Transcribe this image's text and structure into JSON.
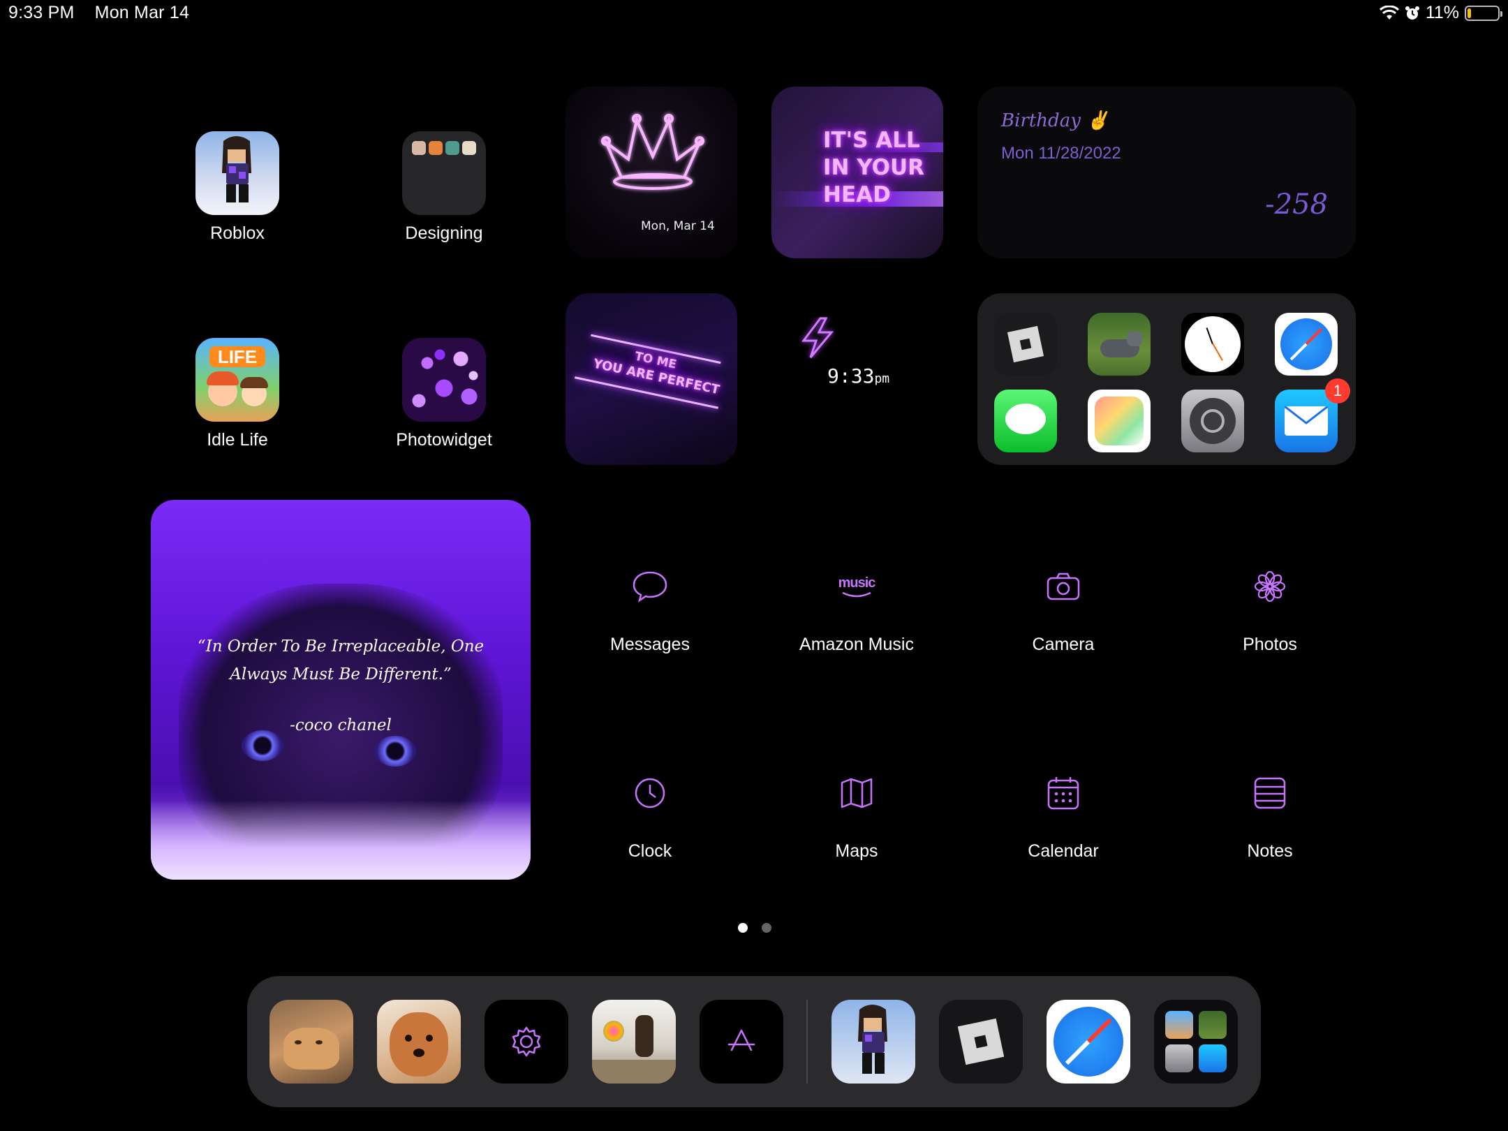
{
  "status_bar": {
    "time": "9:33 PM",
    "date": "Mon Mar 14",
    "battery": "11%",
    "battery_level": 0.11
  },
  "apps": {
    "roblox": "Roblox",
    "designing": "Designing",
    "idle_life": "Idle Life",
    "photowidget": "Photowidget"
  },
  "widgets": {
    "crown_date": "Mon, Mar 14",
    "neon_head": [
      "IT'S ALL",
      "IN YOUR",
      "HEAD"
    ],
    "perfect_sign": [
      "TO ME",
      "YOU ARE PERFECT"
    ],
    "clock_time": "9:33",
    "clock_suffix": "pm",
    "countdown_title": "Birthday ✌️",
    "countdown_date": "Mon 11/28/2022",
    "countdown_value": "-258",
    "quote": "“In Order To Be Irreplaceable, One Always Must Be Different.”",
    "quote_author": "-coco chanel",
    "mail_badge": "1"
  },
  "outline_apps": [
    {
      "label": "Messages",
      "icon": "message-bubble-icon"
    },
    {
      "label": "Amazon Music",
      "icon": "amazon-music-icon",
      "glyph": "music"
    },
    {
      "label": "Camera",
      "icon": "camera-icon"
    },
    {
      "label": "Photos",
      "icon": "flower-icon"
    },
    {
      "label": "Clock",
      "icon": "clock-icon"
    },
    {
      "label": "Maps",
      "icon": "map-icon"
    },
    {
      "label": "Calendar",
      "icon": "calendar-icon"
    },
    {
      "label": "Notes",
      "icon": "notes-icon"
    }
  ],
  "colors": {
    "accent": "#c874ff",
    "neon": "#d45cff",
    "dock_bg": "#2b2b2e",
    "badge": "#ff3b30"
  }
}
